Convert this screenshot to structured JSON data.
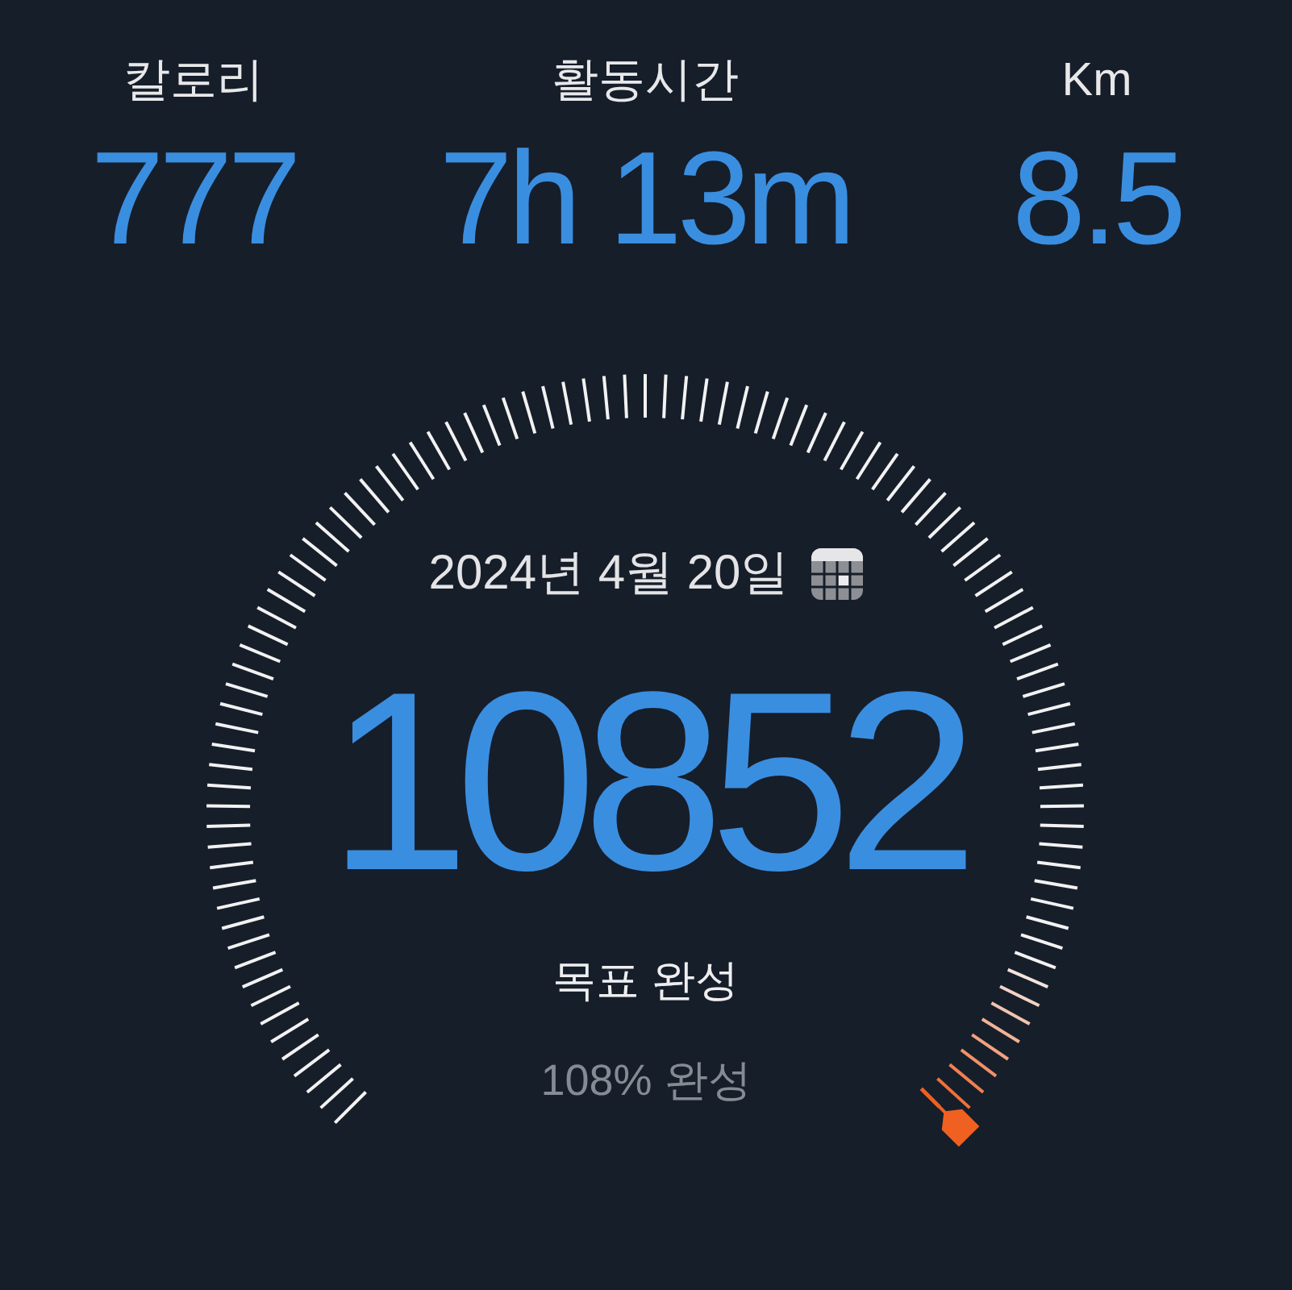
{
  "stats": [
    {
      "label": "칼로리",
      "value": "777"
    },
    {
      "label": "활동시간",
      "value": "7h 13m"
    },
    {
      "label": "Km",
      "value": "8.5"
    }
  ],
  "gauge": {
    "date": "2024년 4월 20일",
    "steps": "10852",
    "status": "목표 완성",
    "percent": "108% 완성"
  }
}
